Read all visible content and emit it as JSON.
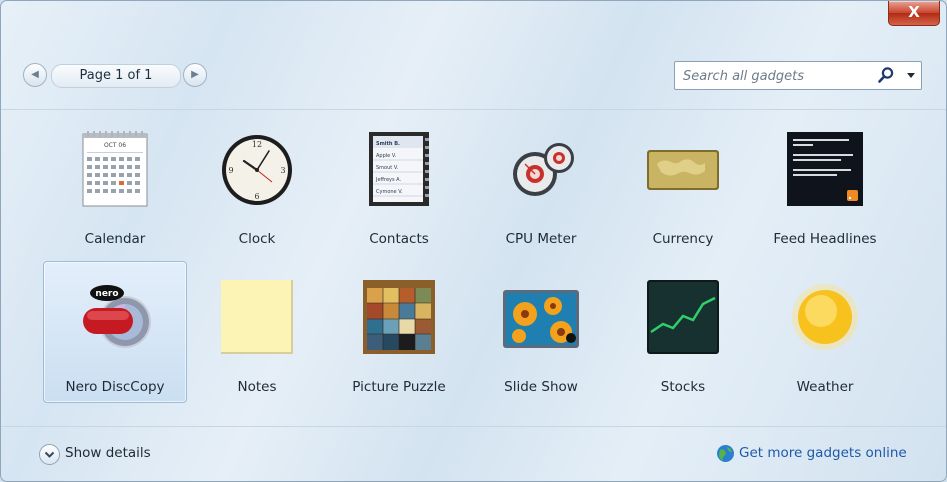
{
  "window": {
    "close_label": "X"
  },
  "pager": {
    "label": "Page 1 of 1"
  },
  "search": {
    "placeholder": "Search all gadgets",
    "value": ""
  },
  "gadgets": [
    {
      "label": "Calendar",
      "icon": "calendar-icon"
    },
    {
      "label": "Clock",
      "icon": "clock-icon"
    },
    {
      "label": "Contacts",
      "icon": "contacts-icon"
    },
    {
      "label": "CPU Meter",
      "icon": "cpu-meter-icon"
    },
    {
      "label": "Currency",
      "icon": "currency-icon"
    },
    {
      "label": "Feed Headlines",
      "icon": "feed-headlines-icon"
    },
    {
      "label": "Nero DiscCopy",
      "icon": "nero-disccopy-icon",
      "selected": true
    },
    {
      "label": "Notes",
      "icon": "notes-icon"
    },
    {
      "label": "Picture Puzzle",
      "icon": "picture-puzzle-icon"
    },
    {
      "label": "Slide Show",
      "icon": "slide-show-icon"
    },
    {
      "label": "Stocks",
      "icon": "stocks-icon"
    },
    {
      "label": "Weather",
      "icon": "weather-icon"
    }
  ],
  "thumbnails": {
    "calendar_month": "OCT 06",
    "contacts_names": [
      "Smith B.",
      "Apple V.",
      "Smout V.",
      "Jeffreys A.",
      "Cymone V."
    ],
    "nero_logo": "nero"
  },
  "footer": {
    "details_label": "Show details",
    "more_label": "Get more gadgets online"
  },
  "colors": {
    "link": "#1e5aa8",
    "selection": "#cadff2",
    "close": "#c9432c"
  }
}
